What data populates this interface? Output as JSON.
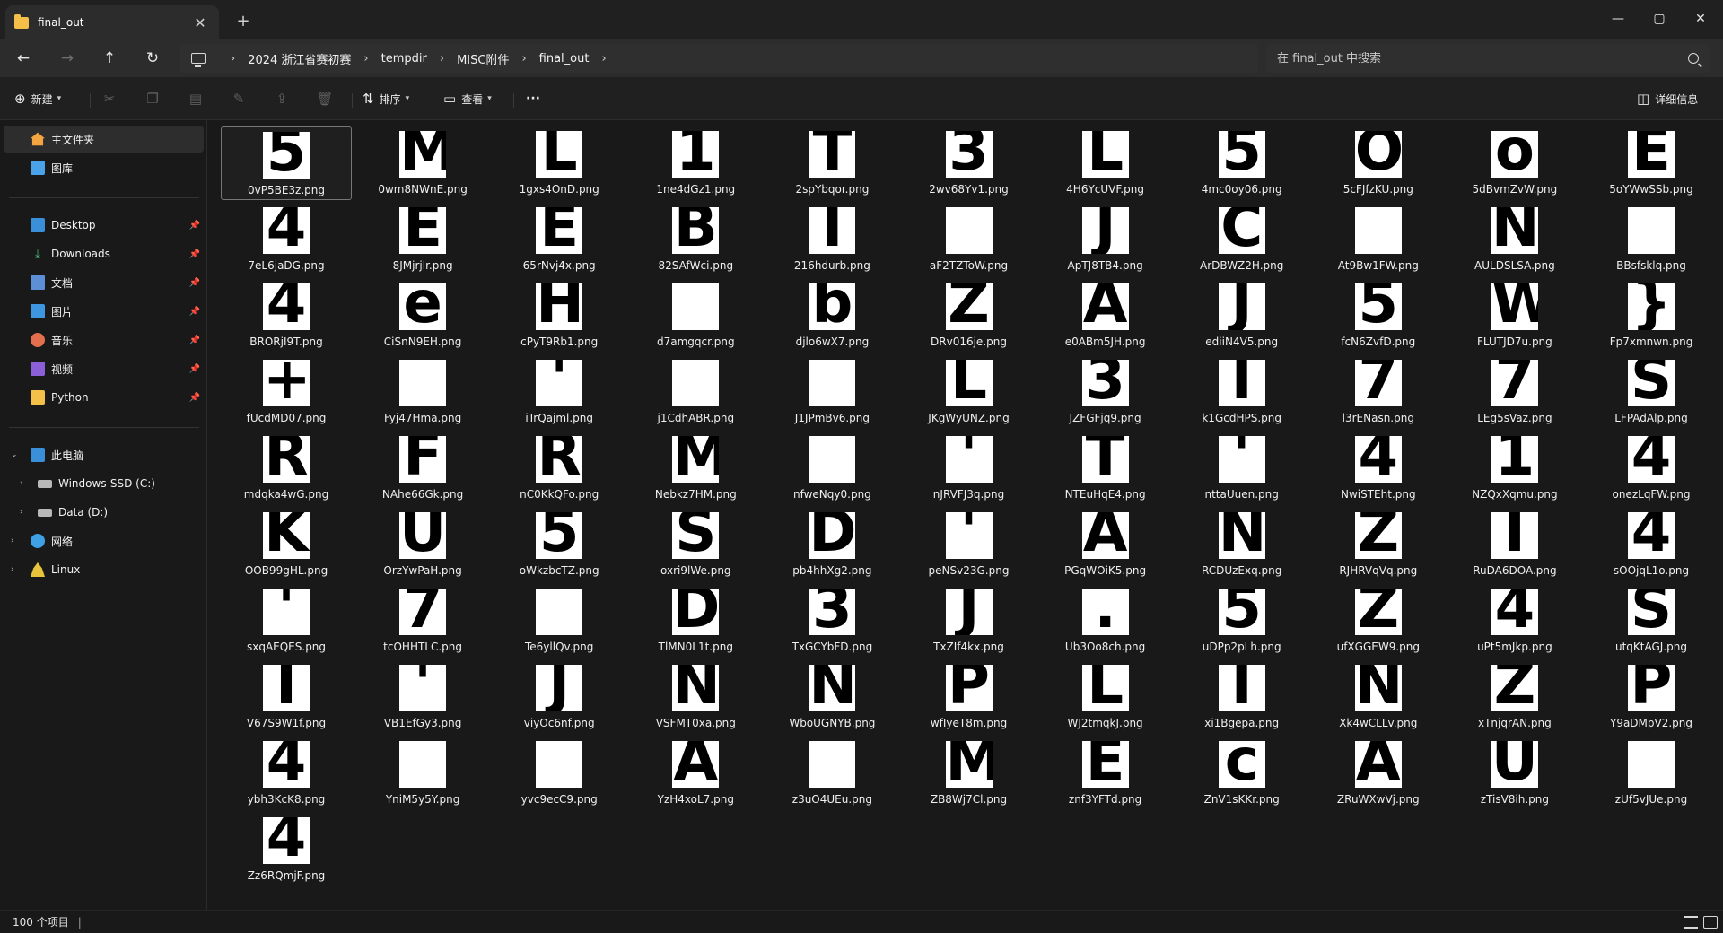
{
  "tab": {
    "title": "final_out",
    "close_glyph": "✕",
    "new_tab_glyph": "+"
  },
  "window_controls": {
    "minimize": "—",
    "maximize": "▢",
    "close": "✕"
  },
  "nav": {
    "back": "←",
    "forward": "→",
    "up": "↑",
    "refresh": "↻"
  },
  "breadcrumb": {
    "separator": "›",
    "items": [
      "2024 浙江省赛初赛",
      "tempdir",
      "MISC附件",
      "final_out"
    ]
  },
  "search": {
    "placeholder": "在 final_out 中搜索"
  },
  "toolbar": {
    "new_label": "新建",
    "sort_label": "排序",
    "view_label": "查看",
    "more_label": "···",
    "details_label": "详细信息"
  },
  "sidebar": {
    "home": "主文件夹",
    "gallery": "图库",
    "quick": [
      {
        "label": "Desktop",
        "icon": "desktop-icon"
      },
      {
        "label": "Downloads",
        "icon": "download-icon"
      },
      {
        "label": "文档",
        "icon": "document-icon"
      },
      {
        "label": "图片",
        "icon": "pictures-icon"
      },
      {
        "label": "音乐",
        "icon": "music-icon"
      },
      {
        "label": "视频",
        "icon": "video-icon"
      },
      {
        "label": "Python",
        "icon": "folder-icon"
      }
    ],
    "this_pc": "此电脑",
    "drives": [
      "Windows-SSD (C:)",
      "Data (D:)"
    ],
    "network": "网络",
    "linux": "Linux"
  },
  "files": [
    {
      "name": "0vP5BE3z.png",
      "glyph": "5"
    },
    {
      "name": "0wm8NWnE.png",
      "glyph": "M"
    },
    {
      "name": "1gxs4OnD.png",
      "glyph": "L"
    },
    {
      "name": "1ne4dGz1.png",
      "glyph": "1"
    },
    {
      "name": "2spYbqor.png",
      "glyph": "T"
    },
    {
      "name": "2wv68Yv1.png",
      "glyph": "3"
    },
    {
      "name": "4H6YcUVF.png",
      "glyph": "L"
    },
    {
      "name": "4mc0oy06.png",
      "glyph": "5"
    },
    {
      "name": "5cFJfzKU.png",
      "glyph": "O"
    },
    {
      "name": "5dBvmZvW.png",
      "glyph": "o"
    },
    {
      "name": "5oYWwSSb.png",
      "glyph": "E"
    },
    {
      "name": "7eL6jaDG.png",
      "glyph": "4"
    },
    {
      "name": "8JMjrjlr.png",
      "glyph": "E"
    },
    {
      "name": "65rNvj4x.png",
      "glyph": "E"
    },
    {
      "name": "82SAfWci.png",
      "glyph": "B"
    },
    {
      "name": "216hdurb.png",
      "glyph": "I"
    },
    {
      "name": "aF2TZToW.png",
      "glyph": ""
    },
    {
      "name": "ApTJ8TB4.png",
      "glyph": "J"
    },
    {
      "name": "ArDBWZ2H.png",
      "glyph": "C"
    },
    {
      "name": "At9Bw1FW.png",
      "glyph": ""
    },
    {
      "name": "AULDSLSA.png",
      "glyph": "N"
    },
    {
      "name": "BBsfsklq.png",
      "glyph": "_"
    },
    {
      "name": "BRORjI9T.png",
      "glyph": "4"
    },
    {
      "name": "CiSnN9EH.png",
      "glyph": "e"
    },
    {
      "name": "cPyT9Rb1.png",
      "glyph": "H"
    },
    {
      "name": "d7amgqcr.png",
      "glyph": ""
    },
    {
      "name": "djlo6wX7.png",
      "glyph": "b"
    },
    {
      "name": "DRv016je.png",
      "glyph": "Z"
    },
    {
      "name": "e0ABm5JH.png",
      "glyph": "A"
    },
    {
      "name": "ediiN4V5.png",
      "glyph": "J"
    },
    {
      "name": "fcN6ZvfD.png",
      "glyph": "5"
    },
    {
      "name": "FLUTJD7u.png",
      "glyph": "W"
    },
    {
      "name": "Fp7xmnwn.png",
      "glyph": "}"
    },
    {
      "name": "fUcdMD07.png",
      "glyph": "+"
    },
    {
      "name": "Fyj47Hma.png",
      "glyph": ""
    },
    {
      "name": "iTrQajml.png",
      "glyph": "'"
    },
    {
      "name": "j1CdhABR.png",
      "glyph": ""
    },
    {
      "name": "J1JPmBv6.png",
      "glyph": ""
    },
    {
      "name": "JKgWyUNZ.png",
      "glyph": "L"
    },
    {
      "name": "JZFGFjq9.png",
      "glyph": "3"
    },
    {
      "name": "k1GcdHPS.png",
      "glyph": "I"
    },
    {
      "name": "l3rENasn.png",
      "glyph": "7"
    },
    {
      "name": "LEg5sVaz.png",
      "glyph": "7"
    },
    {
      "name": "LFPAdAlp.png",
      "glyph": "S"
    },
    {
      "name": "mdqka4wG.png",
      "glyph": "R"
    },
    {
      "name": "NAhe66Gk.png",
      "glyph": "F"
    },
    {
      "name": "nC0KkQFo.png",
      "glyph": "R"
    },
    {
      "name": "Nebkz7HM.png",
      "glyph": "M"
    },
    {
      "name": "nfweNqy0.png",
      "glyph": ""
    },
    {
      "name": "nJRVFJ3q.png",
      "glyph": "'"
    },
    {
      "name": "NTEuHqE4.png",
      "glyph": "T"
    },
    {
      "name": "nttaUuen.png",
      "glyph": "'"
    },
    {
      "name": "NwiSTEht.png",
      "glyph": "4"
    },
    {
      "name": "NZQxXqmu.png",
      "glyph": "1"
    },
    {
      "name": "onezLqFW.png",
      "glyph": "4"
    },
    {
      "name": "OOB99gHL.png",
      "glyph": "K"
    },
    {
      "name": "OrzYwPaH.png",
      "glyph": "U"
    },
    {
      "name": "oWkzbcTZ.png",
      "glyph": "5"
    },
    {
      "name": "oxri9lWe.png",
      "glyph": "S"
    },
    {
      "name": "pb4hhXg2.png",
      "glyph": "D"
    },
    {
      "name": "peNSv23G.png",
      "glyph": "'"
    },
    {
      "name": "PGqWOiK5.png",
      "glyph": "A"
    },
    {
      "name": "RCDUzExq.png",
      "glyph": "N"
    },
    {
      "name": "RJHRVqVq.png",
      "glyph": "Z"
    },
    {
      "name": "RuDA6DOA.png",
      "glyph": "I"
    },
    {
      "name": "sOOjqL1o.png",
      "glyph": "4"
    },
    {
      "name": "sxqAEQES.png",
      "glyph": "'"
    },
    {
      "name": "tcOHHTLC.png",
      "glyph": "7"
    },
    {
      "name": "Te6yllQv.png",
      "glyph": ""
    },
    {
      "name": "TlMN0L1t.png",
      "glyph": "D"
    },
    {
      "name": "TxGCYbFD.png",
      "glyph": "3"
    },
    {
      "name": "TxZIf4kx.png",
      "glyph": "J"
    },
    {
      "name": "Ub3Oo8ch.png",
      "glyph": "."
    },
    {
      "name": "uDPp2pLh.png",
      "glyph": "5"
    },
    {
      "name": "ufXGGEW9.png",
      "glyph": "Z"
    },
    {
      "name": "uPt5mJkp.png",
      "glyph": "4"
    },
    {
      "name": "utqKtAGJ.png",
      "glyph": "S"
    },
    {
      "name": "V67S9W1f.png",
      "glyph": "I"
    },
    {
      "name": "VB1EfGy3.png",
      "glyph": "'"
    },
    {
      "name": "viyOc6nf.png",
      "glyph": "J"
    },
    {
      "name": "VSFMT0xa.png",
      "glyph": "N"
    },
    {
      "name": "WboUGNYB.png",
      "glyph": "N"
    },
    {
      "name": "wfIyeT8m.png",
      "glyph": "P"
    },
    {
      "name": "WJ2tmqkJ.png",
      "glyph": "L"
    },
    {
      "name": "xi1Bgepa.png",
      "glyph": "I"
    },
    {
      "name": "Xk4wCLLv.png",
      "glyph": "N"
    },
    {
      "name": "xTnjqrAN.png",
      "glyph": "Z"
    },
    {
      "name": "Y9aDMpV2.png",
      "glyph": "P"
    },
    {
      "name": "ybh3KcK8.png",
      "glyph": "4"
    },
    {
      "name": "YniM5y5Y.png",
      "glyph": "_"
    },
    {
      "name": "yvc9ecC9.png",
      "glyph": ""
    },
    {
      "name": "YzH4xoL7.png",
      "glyph": "A"
    },
    {
      "name": "z3uO4UEu.png",
      "glyph": "_"
    },
    {
      "name": "ZB8Wj7Cl.png",
      "glyph": "M"
    },
    {
      "name": "znf3YFTd.png",
      "glyph": "E"
    },
    {
      "name": "ZnV1sKKr.png",
      "glyph": "c"
    },
    {
      "name": "ZRuWXwVj.png",
      "glyph": "A"
    },
    {
      "name": "zTisV8ih.png",
      "glyph": "U"
    },
    {
      "name": "zUf5vJUe.png",
      "glyph": "_"
    },
    {
      "name": "Zz6RQmjF.png",
      "glyph": "4"
    }
  ],
  "status": {
    "count": "100 个项目",
    "separator": "|"
  }
}
